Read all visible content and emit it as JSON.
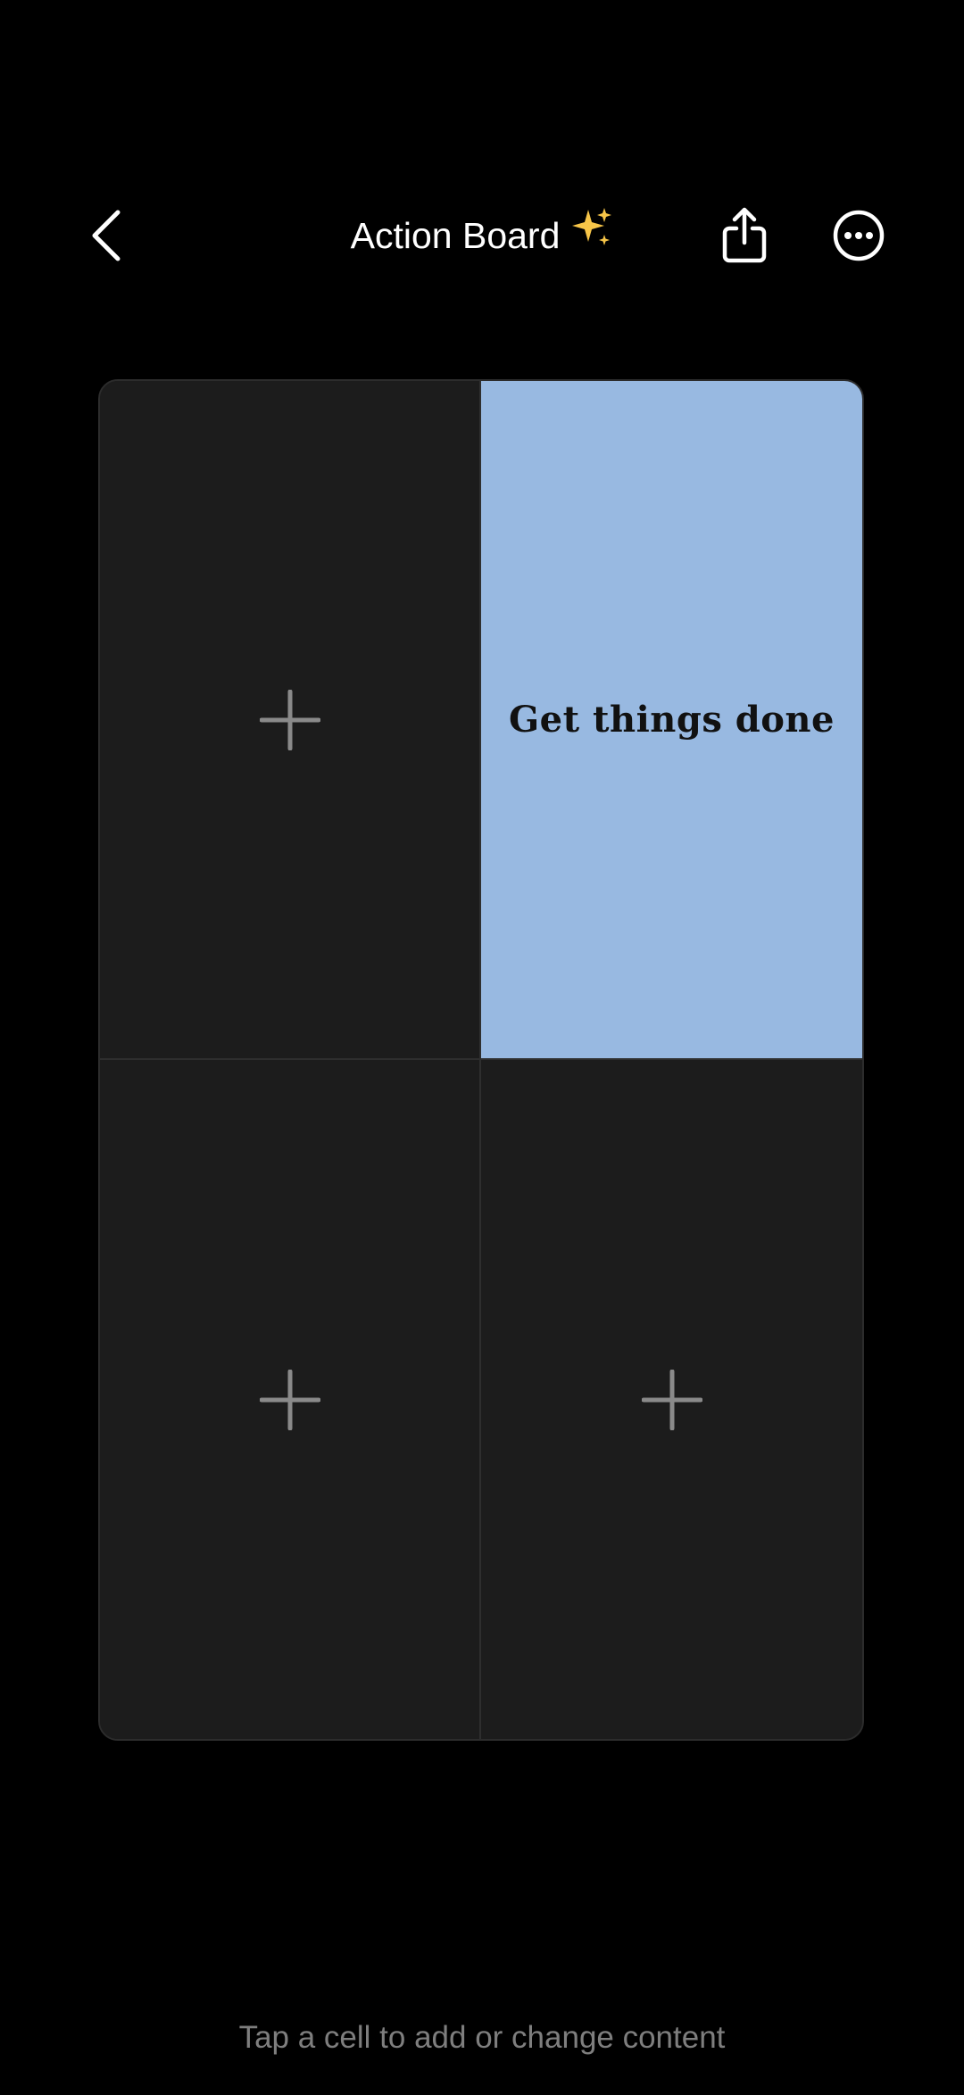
{
  "header": {
    "title": "Action Board",
    "title_emoji": "✨",
    "back_icon": "chevron-left-icon",
    "share_icon": "share-icon",
    "more_icon": "more-horizontal-circle-icon"
  },
  "board": {
    "cells": [
      {
        "state": "empty",
        "icon": "plus-icon"
      },
      {
        "state": "filled",
        "text": "Get things done",
        "color": "#98b9e1"
      },
      {
        "state": "empty",
        "icon": "plus-icon"
      },
      {
        "state": "empty",
        "icon": "plus-icon"
      }
    ]
  },
  "footer": {
    "hint": "Tap a cell to add or change content"
  },
  "colors": {
    "background": "#000000",
    "cell_empty": "#1c1c1c",
    "cell_filled": "#98b9e1",
    "plus": "#8a8a8a",
    "hint_text": "#7e7e7e"
  }
}
